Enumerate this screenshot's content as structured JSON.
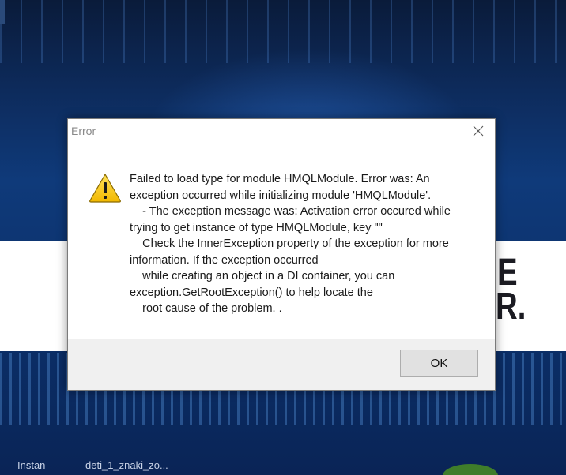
{
  "dialog": {
    "title": "Error",
    "icon": "warning-triangle-icon",
    "message_lines": [
      "Failed to load type for module HMQLModule. Error was: An",
      "exception occurred while initializing module 'HMQLModule'.",
      "    - The exception message was: Activation error occured while",
      "trying to get instance of type HMQLModule, key \"\"",
      "    Check the InnerException property of the exception for more",
      "information. If the exception occurred",
      "    while creating an object in a DI container, you can",
      "exception.GetRootException() to help locate the",
      "    root cause of the problem. ."
    ],
    "ok_label": "OK"
  },
  "background": {
    "letters": [
      "E",
      "R."
    ],
    "taskbar_items": [
      "Instan",
      "deti_1_znaki_zo..."
    ]
  },
  "colors": {
    "warning_fill": "#f7c600",
    "warning_border": "#8a6a00",
    "footer_bg": "#f0f0f0",
    "button_bg": "#e1e1e1"
  }
}
